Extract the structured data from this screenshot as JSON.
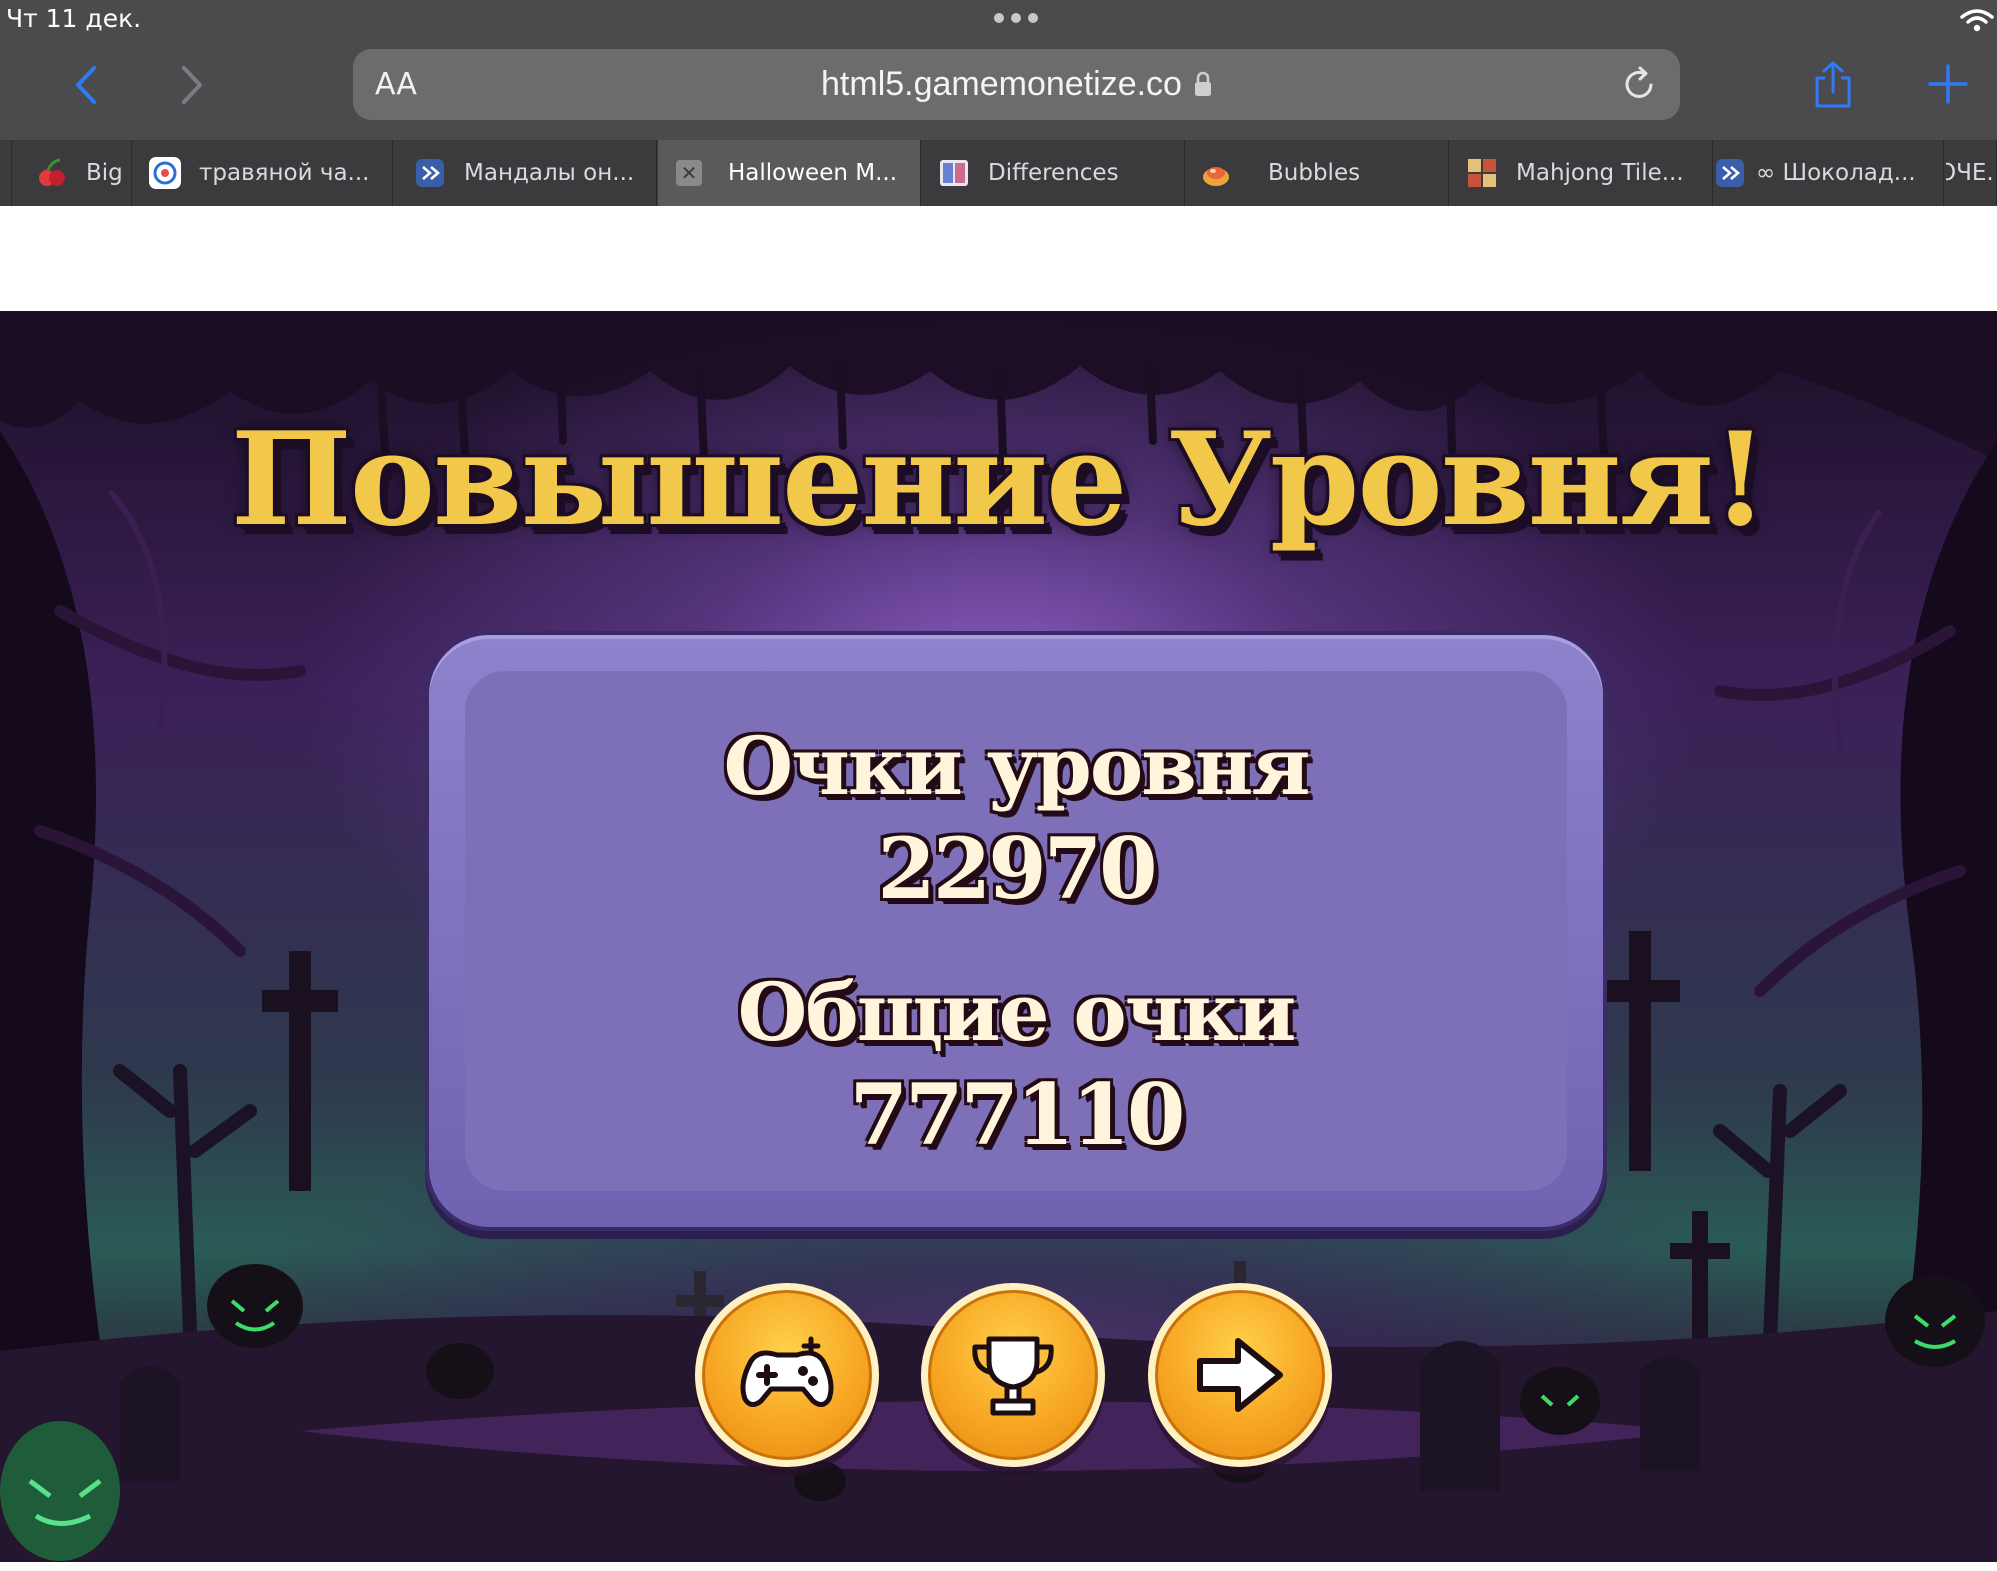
{
  "status_bar": {
    "time": "Чт 11 дек.",
    "icons": [
      "more-dots-icon",
      "wifi-icon"
    ]
  },
  "browser": {
    "reader_label": "AA",
    "url": "html5.gamemonetize.co",
    "tabs": [
      {
        "label": "Big",
        "icon": "cherry-favicon"
      },
      {
        "label": "травяной ча...",
        "icon": "chat-favicon"
      },
      {
        "label": "Мандалы он...",
        "icon": "site-favicon"
      },
      {
        "label": "Halloween M...",
        "icon": "close-icon",
        "active": true
      },
      {
        "label": "Differences",
        "icon": "puzzle-favicon"
      },
      {
        "label": "Bubbles",
        "icon": "bubble-favicon"
      },
      {
        "label": "Mahjong Tile...",
        "icon": "mahjong-favicon"
      },
      {
        "label": "∞ Шоколад...",
        "icon": "site-favicon"
      },
      {
        "label": "ОЧЕ...",
        "icon": ""
      }
    ]
  },
  "game": {
    "title": "Повышение Уровня!",
    "level_score_label": "Очки уровня",
    "level_score": "22970",
    "total_score_label": "Общие очки",
    "total_score": "777110",
    "buttons": [
      "gamepad-icon",
      "trophy-icon",
      "arrow-right-icon"
    ]
  },
  "colors": {
    "title_gold": "#f2c84a",
    "panel_purple": "#7d70b8",
    "button_orange": "#f7a623",
    "browser_chrome": "#4b4b4d",
    "accent_blue": "#2f7bf6"
  }
}
